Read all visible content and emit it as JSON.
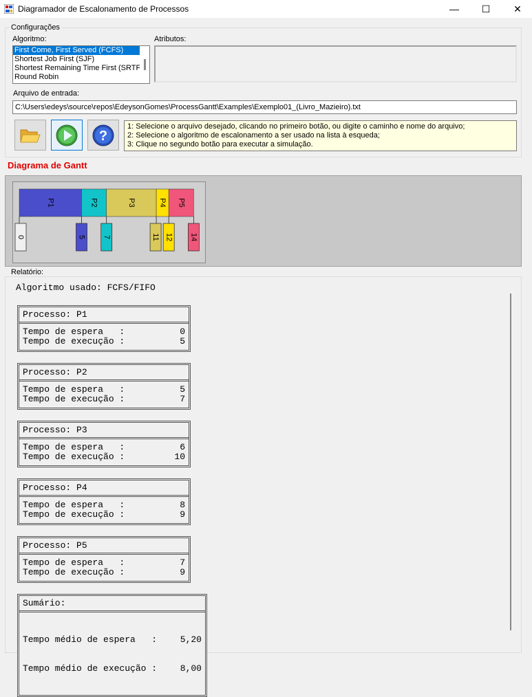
{
  "window": {
    "title": "Diagramador de Escalonamento de Processos",
    "minimize": "—",
    "maximize": "☐",
    "close": "✕"
  },
  "config": {
    "group_label": "Configurações",
    "algorithm_label": "Algoritmo:",
    "attributes_label": "Atributos:",
    "algorithms": [
      {
        "label": "First Come, First Served (FCFS)",
        "selected": true
      },
      {
        "label": "Shortest Job First (SJF)",
        "selected": false
      },
      {
        "label": "Shortest Remaining Time First (SRTF)",
        "selected": false
      },
      {
        "label": "Round Robin",
        "selected": false
      }
    ],
    "input_file_label": "Arquivo de entrada:",
    "input_file_value": "C:\\Users\\edeys\\source\\repos\\EdeysonGomes\\ProcessGantt\\Examples\\Exemplo01_(Livro_Mazieiro).txt",
    "buttons": [
      {
        "name": "open-file-button",
        "icon": "folder-icon"
      },
      {
        "name": "run-button",
        "icon": "play-icon"
      },
      {
        "name": "help-button",
        "icon": "help-icon"
      }
    ],
    "help_lines": [
      "1: Selecione o arquivo desejado, clicando no primeiro botão, ou digite o caminho e nome do arquivo;",
      "2: Selecione o algoritmo de escalonamento a ser usado na lista à esqueda;",
      "3: Clique no segundo botão para executar a simulação."
    ]
  },
  "gantt": {
    "title": "Diagrama de Gantt",
    "colors": {
      "P1": "#4a4ecb",
      "P2": "#12c4c9",
      "P3": "#d9c85a",
      "P4": "#ffe000",
      "P5": "#f0557a"
    },
    "segments": [
      {
        "label": "P1",
        "start": 0,
        "end": 5
      },
      {
        "label": "P2",
        "start": 5,
        "end": 7
      },
      {
        "label": "P3",
        "start": 7,
        "end": 11
      },
      {
        "label": "P4",
        "start": 11,
        "end": 12
      },
      {
        "label": "P5",
        "start": 12,
        "end": 14
      }
    ],
    "ticks": [
      {
        "label": "0",
        "time": 0,
        "color": "#f0f0f0"
      },
      {
        "label": "5",
        "time": 5,
        "color": "#4a4ecb"
      },
      {
        "label": "7",
        "time": 7,
        "color": "#12c4c9"
      },
      {
        "label": "11",
        "time": 11,
        "color": "#d9c85a"
      },
      {
        "label": "12",
        "time": 12,
        "color": "#ffe000"
      },
      {
        "label": "14",
        "time": 14,
        "color": "#f0557a"
      }
    ]
  },
  "report": {
    "label": "Relatório:",
    "algorithm_line": "Algoritmo usado: FCFS/FIFO",
    "wait_label": "Tempo de espera   :",
    "exec_label": "Tempo de execução :",
    "processes": [
      {
        "title": "Processo: P1",
        "wait": "0",
        "exec": "5"
      },
      {
        "title": "Processo: P2",
        "wait": "5",
        "exec": "7"
      },
      {
        "title": "Processo: P3",
        "wait": "6",
        "exec": "10"
      },
      {
        "title": "Processo: P4",
        "wait": "8",
        "exec": "9"
      },
      {
        "title": "Processo: P5",
        "wait": "7",
        "exec": "9"
      }
    ],
    "summary": {
      "title": "Sumário:",
      "avg_wait_label": "Tempo médio de espera   :",
      "avg_wait": "5,20",
      "avg_exec_label": "Tempo médio de execução :",
      "avg_exec": "8,00"
    }
  }
}
